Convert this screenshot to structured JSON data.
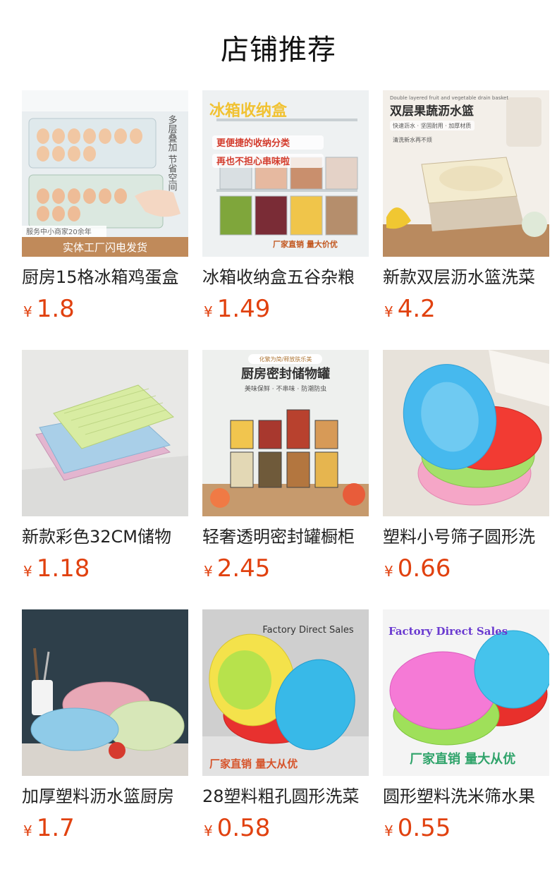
{
  "page_title": "店铺推荐",
  "currency_symbol": "¥",
  "products": [
    {
      "name": "厨房15格冰箱鸡蛋盒",
      "price": "1.8",
      "image_texts": [
        "服务中小商家20余年",
        "实体工厂闪电发货",
        "多层叠加 节省空间"
      ]
    },
    {
      "name": "冰箱收纳盒五谷杂粮",
      "price": "1.49",
      "image_texts": [
        "冰箱收纳盒",
        "更便捷的收纳分类",
        "再也不担心串味啦",
        "厂家直销 量大价优"
      ]
    },
    {
      "name": "新款双层沥水篮洗菜",
      "price": "4.2",
      "image_texts": [
        "Double layered fruit and vegetable drain basket",
        "双层果蔬沥水篮",
        "快速沥水 · 坚固耐用 · 加厚材质",
        "清洗新水再不烦"
      ]
    },
    {
      "name": "新款彩色32CM储物",
      "price": "1.18",
      "image_texts": []
    },
    {
      "name": "轻奢透明密封罐橱柜",
      "price": "2.45",
      "image_texts": [
        "化繁为简/释放肤乐美",
        "厨房密封储物罐",
        "美味保鲜 · 不串味 · 防潮防虫"
      ]
    },
    {
      "name": "塑料小号筛子圆形洗",
      "price": "0.66",
      "image_texts": []
    },
    {
      "name": "加厚塑料沥水篮厨房",
      "price": "1.7",
      "image_texts": []
    },
    {
      "name": "28塑料粗孔圆形洗菜",
      "price": "0.58",
      "image_texts": [
        "Factory Direct Sales",
        "厂家直销 量大从优"
      ]
    },
    {
      "name": "圆形塑料洗米筛水果",
      "price": "0.55",
      "image_texts": [
        "Factory Direct Sales",
        "厂家直销 量大从优"
      ]
    }
  ]
}
